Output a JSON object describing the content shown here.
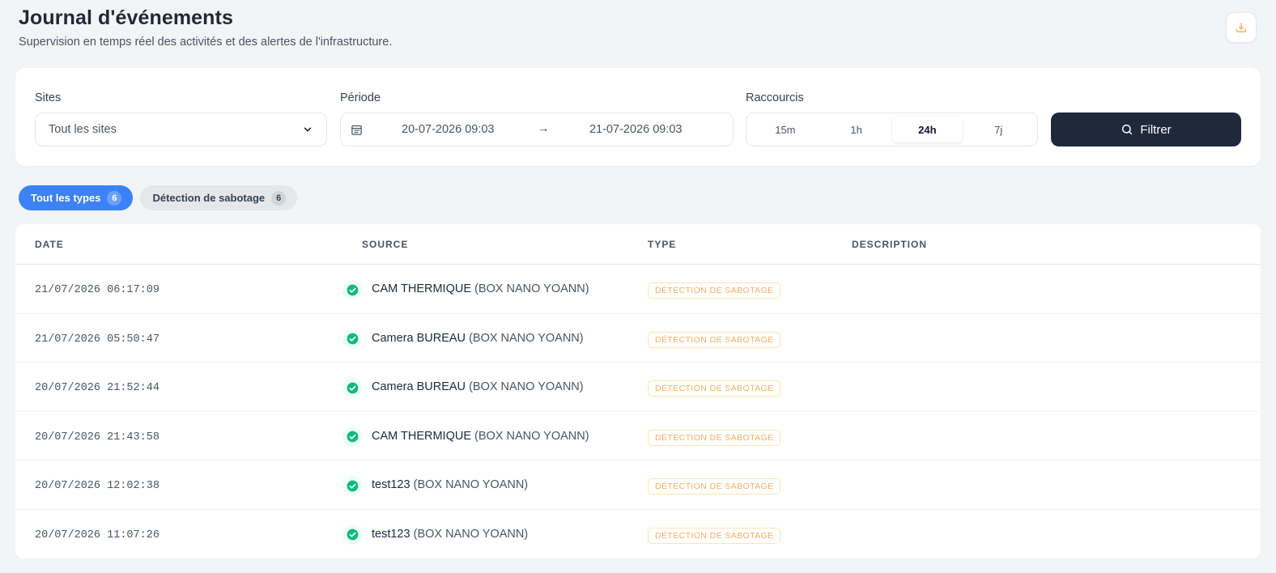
{
  "header": {
    "title": "Journal d'événements",
    "subtitle": "Supervision en temps réel des activités et des alertes de l'infrastructure."
  },
  "filters": {
    "sites_label": "Sites",
    "sites_value": "Tout les sites",
    "period_label": "Période",
    "period_start": "20-07-2026 09:03",
    "period_arrow": "→",
    "period_end": "21-07-2026 09:03",
    "shortcuts_label": "Raccourcis",
    "shortcuts": [
      "15m",
      "1h",
      "24h",
      "7j"
    ],
    "active_shortcut": "24h",
    "filter_button": "Filtrer"
  },
  "type_filters": [
    {
      "label": "Tout les types",
      "count": "6",
      "active": true
    },
    {
      "label": "Détection de sabotage",
      "count": "6",
      "active": false
    }
  ],
  "table": {
    "columns": [
      "DATE",
      "SOURCE",
      "TYPE",
      "DESCRIPTION"
    ],
    "rows": [
      {
        "date": "21/07/2026 06:17:09",
        "source_name": "CAM THERMIQUE",
        "source_box": "(BOX NANO YOANN)",
        "type": "DÉTECTION DE SABOTAGE",
        "description": ""
      },
      {
        "date": "21/07/2026 05:50:47",
        "source_name": "Camera BUREAU",
        "source_box": "(BOX NANO YOANN)",
        "type": "DÉTECTION DE SABOTAGE",
        "description": ""
      },
      {
        "date": "20/07/2026 21:52:44",
        "source_name": "Camera BUREAU",
        "source_box": "(BOX NANO YOANN)",
        "type": "DÉTECTION DE SABOTAGE",
        "description": ""
      },
      {
        "date": "20/07/2026 21:43:58",
        "source_name": "CAM THERMIQUE",
        "source_box": "(BOX NANO YOANN)",
        "type": "DÉTECTION DE SABOTAGE",
        "description": ""
      },
      {
        "date": "20/07/2026 12:02:38",
        "source_name": "test123",
        "source_box": "(BOX NANO YOANN)",
        "type": "DÉTECTION DE SABOTAGE",
        "description": ""
      },
      {
        "date": "20/07/2026 11:07:26",
        "source_name": "test123",
        "source_box": "(BOX NANO YOANN)",
        "type": "DÉTECTION DE SABOTAGE",
        "description": ""
      }
    ]
  },
  "colors": {
    "primary": "#3b82f6",
    "dark_button": "#1e293b",
    "success": "#10b981",
    "badge_warning": "#f0b060",
    "download_icon": "#f0b060"
  },
  "icons": {
    "download": "download-icon",
    "chevron": "chevron-down-icon",
    "calendar": "calendar-icon",
    "search": "search-icon",
    "status": "check-circle-icon"
  }
}
